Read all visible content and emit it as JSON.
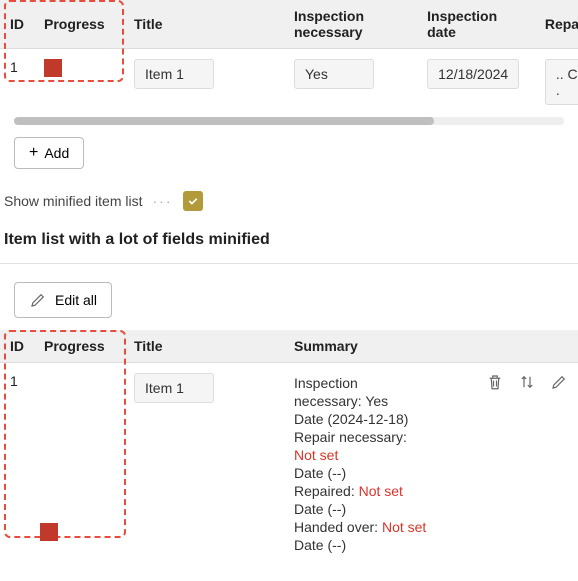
{
  "table1": {
    "headers": {
      "id": "ID",
      "progress": "Progress",
      "title": "Title",
      "inspection": "Inspection necessary",
      "inspection_date": "Inspection date",
      "repair": "Repair nece"
    },
    "row": {
      "id": "1",
      "title": "Item 1",
      "inspection": "Yes",
      "inspection_date": "12/18/2024",
      "repair": ".. Choose ."
    }
  },
  "add_btn": "Add",
  "toggle": {
    "label": "Show minified item list",
    "dash": "···"
  },
  "section_title": "Item list with a lot of fields minified",
  "edit_all": "Edit all",
  "table2": {
    "headers": {
      "id": "ID",
      "progress": "Progress",
      "title": "Title",
      "summary": "Summary"
    },
    "row": {
      "id": "1",
      "title": "Item 1",
      "summary": {
        "l1a": "Inspection",
        "l1b": "necessary: Yes",
        "l2": "Date (2024-12-18)",
        "l3": "Repair necessary:",
        "l3v": "Not set",
        "l4": "Date (--)",
        "l5a": "Repaired: ",
        "l5v": "Not set",
        "l6": "Date (--)",
        "l7a": "Handed over: ",
        "l7v": "Not set",
        "l8": "Date (--)"
      }
    }
  }
}
